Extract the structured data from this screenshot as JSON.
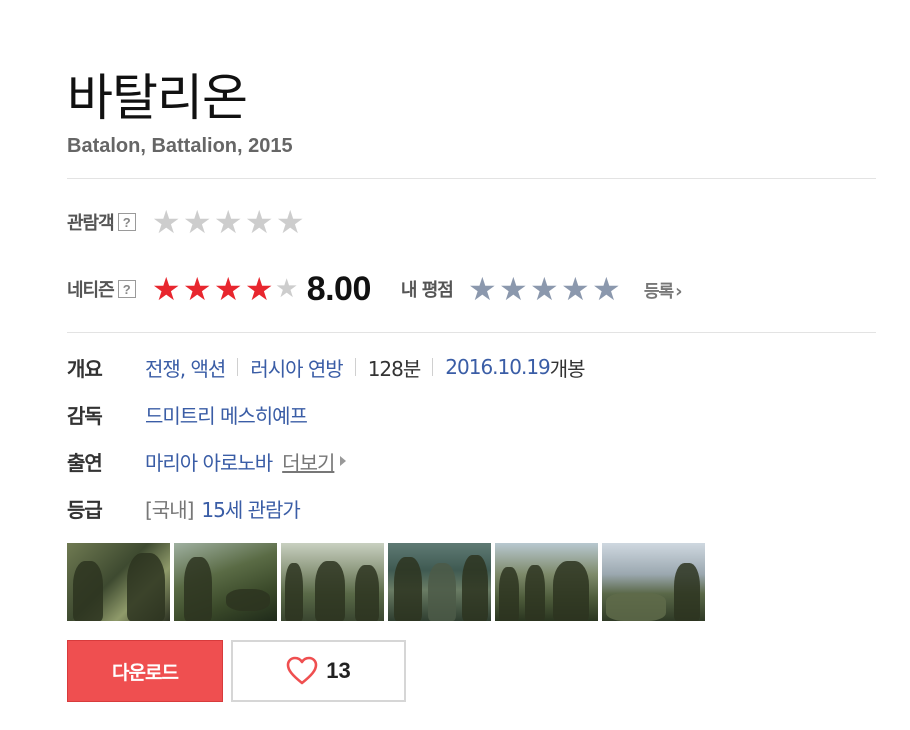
{
  "movie": {
    "title": "바탈리온",
    "subtitle": "Batalon, Battalion, 2015"
  },
  "ratings": {
    "audience": {
      "label": "관람객",
      "help": "?",
      "stars_filled": 0,
      "stars_total": 5
    },
    "netizen": {
      "label": "네티즌",
      "help": "?",
      "stars_filled": 4,
      "stars_total": 5,
      "score": "8.00"
    },
    "my_rating": {
      "label": "내 평점",
      "stars_filled": 0,
      "stars_total": 5,
      "register_label": "등록",
      "register_chevron": "›"
    }
  },
  "info": {
    "overview": {
      "label": "개요",
      "genre": "전쟁, 액션",
      "country": "러시아 연방",
      "runtime": "128분",
      "release_date": "2016.10.19",
      "release_suffix": "개봉"
    },
    "director": {
      "label": "감독",
      "name": "드미트리 메스히예프"
    },
    "cast": {
      "label": "출연",
      "name": "마리아 아로노바",
      "more_label": "더보기"
    },
    "grade": {
      "label": "등급",
      "region": "[국내]",
      "rating": "15세 관람가"
    }
  },
  "stills": [
    "still-1",
    "still-2",
    "still-3",
    "still-4",
    "still-5",
    "still-6"
  ],
  "actions": {
    "download_label": "다운로드",
    "like_count": "13",
    "like_icon": "heart-icon"
  },
  "colors": {
    "accent_red": "#ef4f50",
    "star_red": "#e8262e",
    "star_grey": "#cdcdcd",
    "star_blue": "#8b98ad",
    "link_blue": "#3a5da6"
  }
}
